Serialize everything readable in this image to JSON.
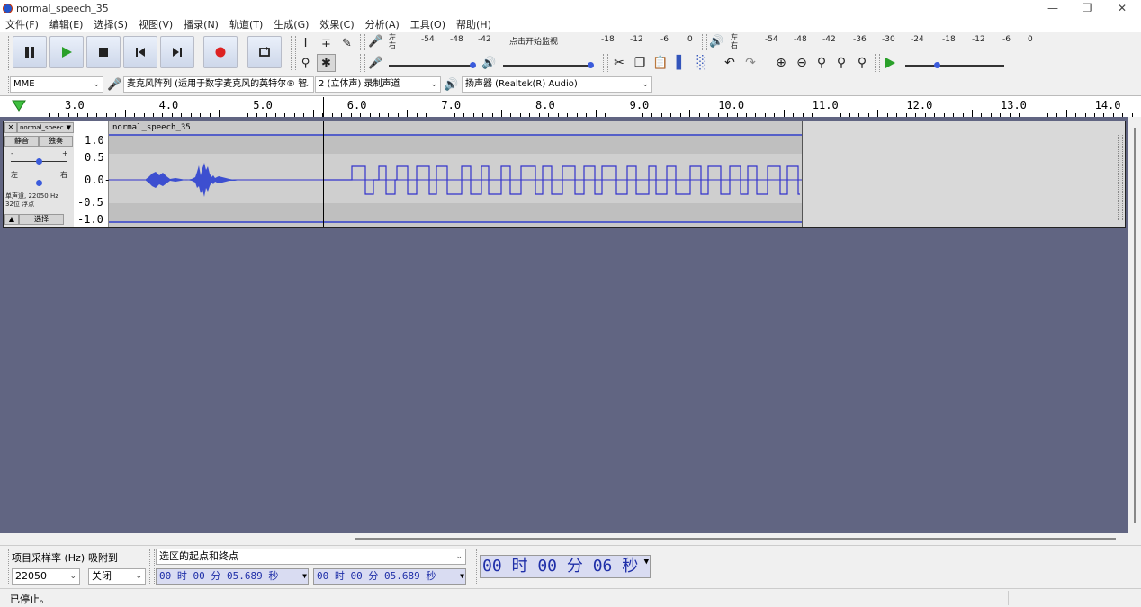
{
  "window": {
    "title": "normal_speech_35"
  },
  "menu": [
    "文件(F)",
    "编辑(E)",
    "选择(S)",
    "视图(V)",
    "播录(N)",
    "轨道(T)",
    "生成(G)",
    "效果(C)",
    "分析(A)",
    "工具(O)",
    "帮助(H)"
  ],
  "transport": {
    "pause": "pause-icon",
    "play": "play-icon",
    "stop": "stop-icon",
    "skip_start": "skip-start-icon",
    "skip_end": "skip-end-icon",
    "record": "record-icon",
    "loop": "loop-icon"
  },
  "record_meter": {
    "ticks": [
      "-54",
      "-48",
      "-42"
    ],
    "click_text": "点击开始监视",
    "ticks2": [
      "-18",
      "-12",
      "-6",
      "0"
    ],
    "left": "左",
    "right": "右"
  },
  "play_meter": {
    "ticks": [
      "-54",
      "-48",
      "-42",
      "-36",
      "-30",
      "-24",
      "-18",
      "-12",
      "-6",
      "0"
    ],
    "left": "左",
    "right": "右"
  },
  "device": {
    "host": "MME",
    "input": "麦克风阵列 (适用于数字麦克风的英特尔® 智",
    "channels": "2 (立体声) 录制声道",
    "output": "扬声器 (Realtek(R) Audio)"
  },
  "ruler": {
    "labels": [
      "3.0",
      "4.0",
      "5.0",
      "6.0",
      "7.0",
      "8.0",
      "9.0",
      "10.0",
      "11.0",
      "12.0",
      "13.0",
      "14.0"
    ]
  },
  "track": {
    "name": "normal_speec",
    "mute": "静音",
    "solo": "独奏",
    "minus": "-",
    "plus": "+",
    "left": "左",
    "right": "右",
    "info1": "单声道, 22050 Hz",
    "info2": "32位 浮点",
    "select": "选择",
    "clip_name": "normal_speech_35",
    "vscale": [
      "1.0",
      "0.5",
      "0.0-",
      "-0.5",
      "-1.0"
    ]
  },
  "selection": {
    "rate_label": "项目采样率 (Hz)",
    "snap_label": "吸附到",
    "rate": "22050",
    "snap": "关闭",
    "mode": "选区的起点和终点",
    "start": "00 时 00 分 05.689 秒",
    "end": "00 时 00 分 05.689 秒",
    "audio_pos": "00 时 00 分 06 秒"
  },
  "status": "已停止。",
  "colors": {
    "wave": "#3333cc",
    "track_bg": "#616582",
    "time_text": "#1f2fa8",
    "record": "#dd2222",
    "play": "#2aa02a"
  }
}
